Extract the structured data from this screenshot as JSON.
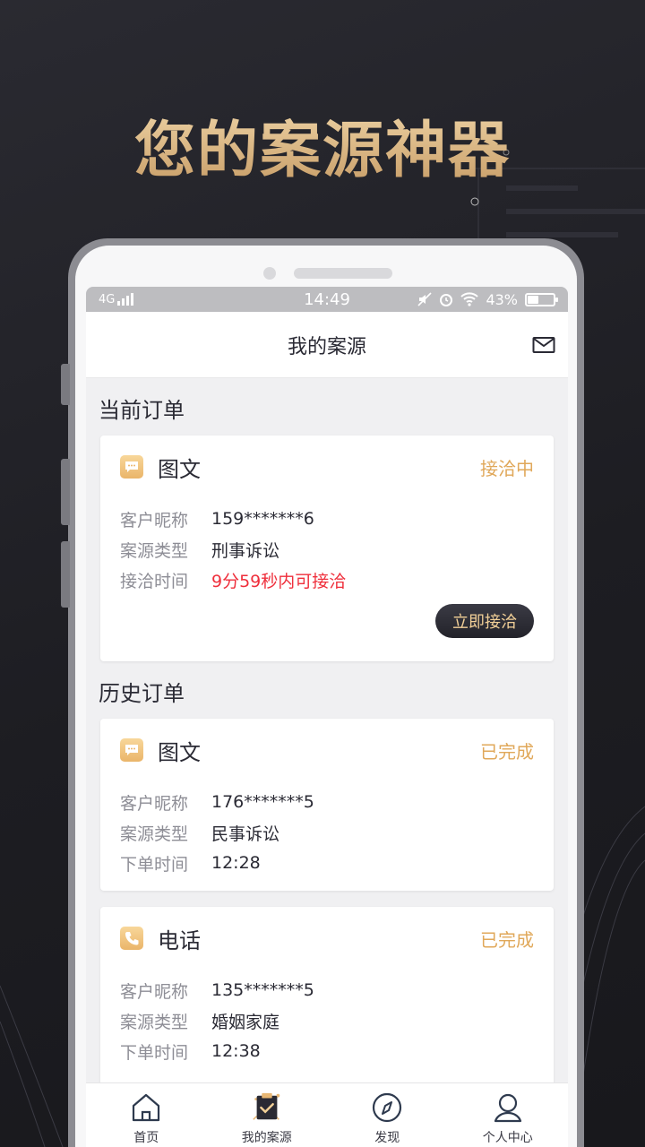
{
  "headline": "您的案源神器",
  "status_bar": {
    "network": "4G",
    "time": "14:49",
    "battery": "43%",
    "battery_level": 0.43
  },
  "navbar": {
    "title": "我的案源",
    "mail_icon": "mail-icon"
  },
  "current_section": {
    "title": "当前订单",
    "order": {
      "type_label": "图文",
      "type_icon": "chat-icon",
      "status": "接洽中",
      "rows": [
        {
          "key": "客户昵称",
          "value": "159*******6"
        },
        {
          "key": "案源类型",
          "value": "刑事诉讼"
        },
        {
          "key": "接洽时间",
          "value": "9分59秒内可接洽"
        }
      ],
      "action_label": "立即接洽"
    }
  },
  "history_section": {
    "title": "历史订单",
    "orders": [
      {
        "type_label": "图文",
        "type_icon": "chat-icon",
        "status": "已完成",
        "rows": [
          {
            "key": "客户昵称",
            "value": "176*******5"
          },
          {
            "key": "案源类型",
            "value": "民事诉讼"
          },
          {
            "key": "下单时间",
            "value": "12:28"
          }
        ]
      },
      {
        "type_label": "电话",
        "type_icon": "phone-icon",
        "status": "已完成",
        "rows": [
          {
            "key": "客户昵称",
            "value": "135*******5"
          },
          {
            "key": "案源类型",
            "value": "婚姻家庭"
          },
          {
            "key": "下单时间",
            "value": "12:38"
          }
        ]
      }
    ]
  },
  "tabbar": {
    "tabs": [
      {
        "label": "首页",
        "icon": "home-icon"
      },
      {
        "label": "我的案源",
        "icon": "clipboard-check-icon",
        "active": true
      },
      {
        "label": "发现",
        "icon": "compass-icon"
      },
      {
        "label": "个人中心",
        "icon": "user-icon"
      }
    ]
  },
  "colors": {
    "accent_gold": "#e0a85a",
    "countdown_red": "#ef2f3c",
    "background_dark": "#1d1d22"
  }
}
